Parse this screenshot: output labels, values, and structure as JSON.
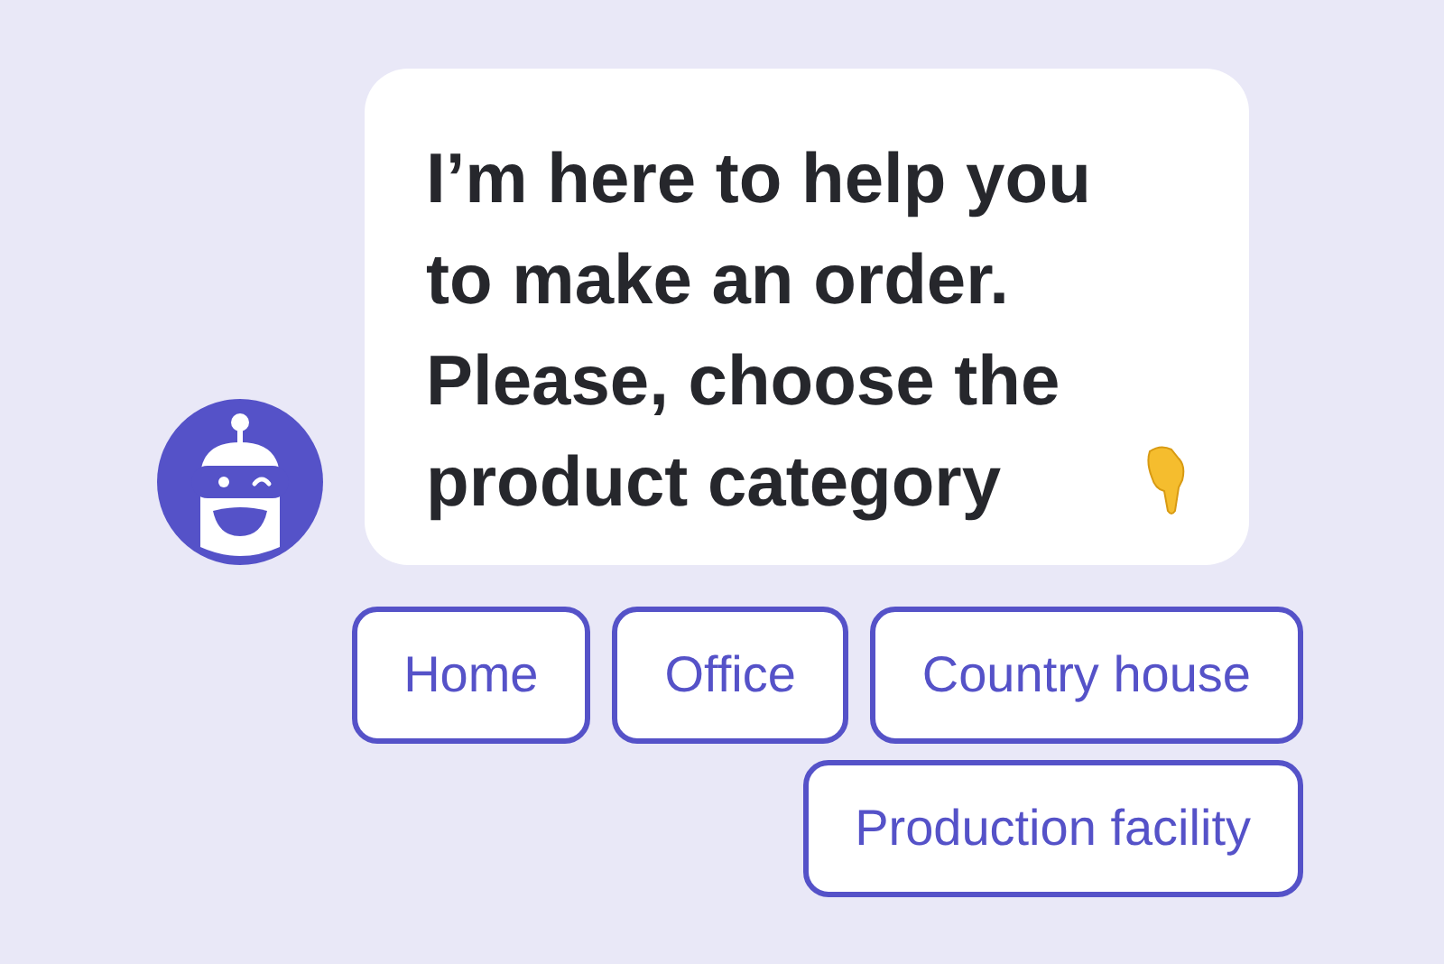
{
  "message": {
    "text": "I’m here to help you to make an order. Please, choose the product category"
  },
  "options": [
    {
      "label": "Home"
    },
    {
      "label": "Office"
    },
    {
      "label": "Country house"
    },
    {
      "label": "Production facility"
    }
  ]
}
